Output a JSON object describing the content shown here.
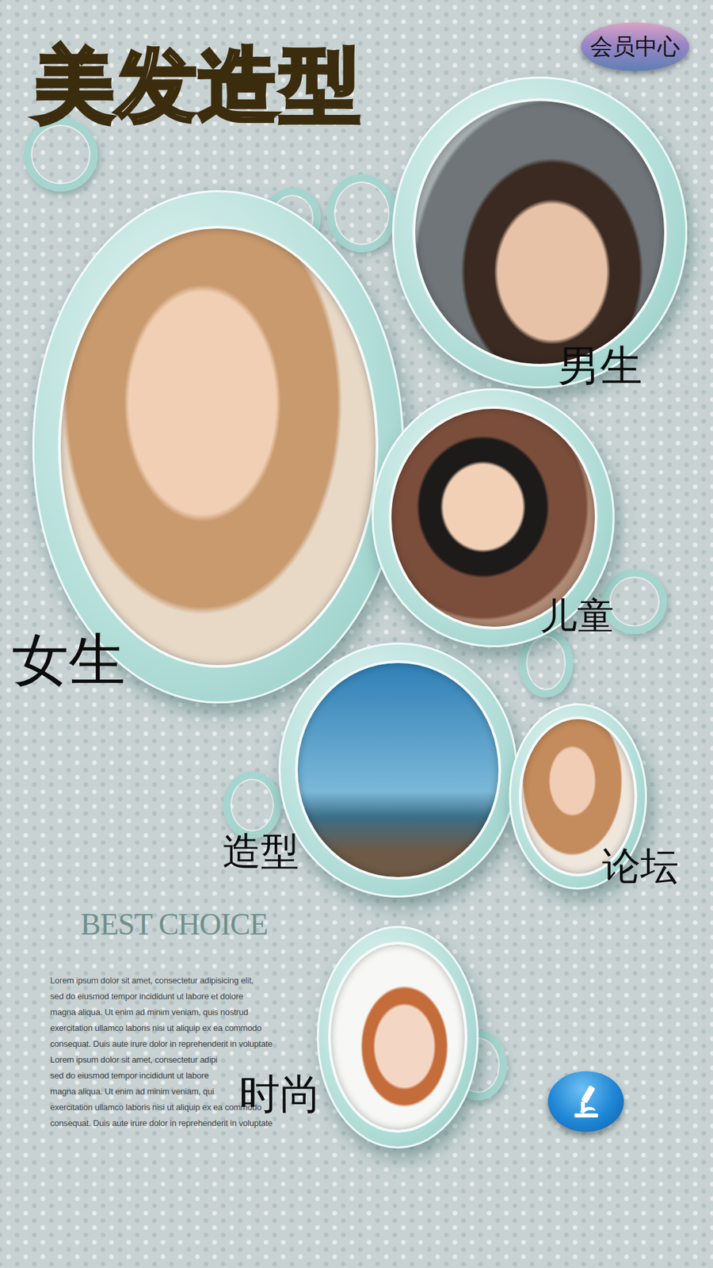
{
  "app": {
    "title": "美发造型",
    "member_button": "会员中心"
  },
  "categories": [
    {
      "label": "男生"
    },
    {
      "label": "儿童"
    },
    {
      "label": "女生"
    },
    {
      "label": "造型"
    },
    {
      "label": "论坛"
    },
    {
      "label": "时尚"
    }
  ],
  "promo": {
    "heading": "BEST CHOICE",
    "lines": [
      "Lorem ipsum dolor sit amet, consectetur adipisicing elit,",
      "sed do eiusmod tempor incididunt ut labore et dolore",
      "magna aliqua. Ut enim ad minim veniam, quis nostrud",
      "exercitation ullamco laboris nisi ut aliquip ex ea commodo",
      "consequat. Duis aute irure dolor in reprehenderit in voluptate",
      "Lorem ipsum dolor sit amet, consectetur adipi",
      "sed do eiusmod tempor incididunt ut labore",
      "magna aliqua. Ut enim ad minim veniam, qui",
      "exercitation ullamco laboris nisi ut aliquip ex ea commodo",
      "consequat. Duis aute irure dolor in reprehenderit in voluptate"
    ]
  }
}
